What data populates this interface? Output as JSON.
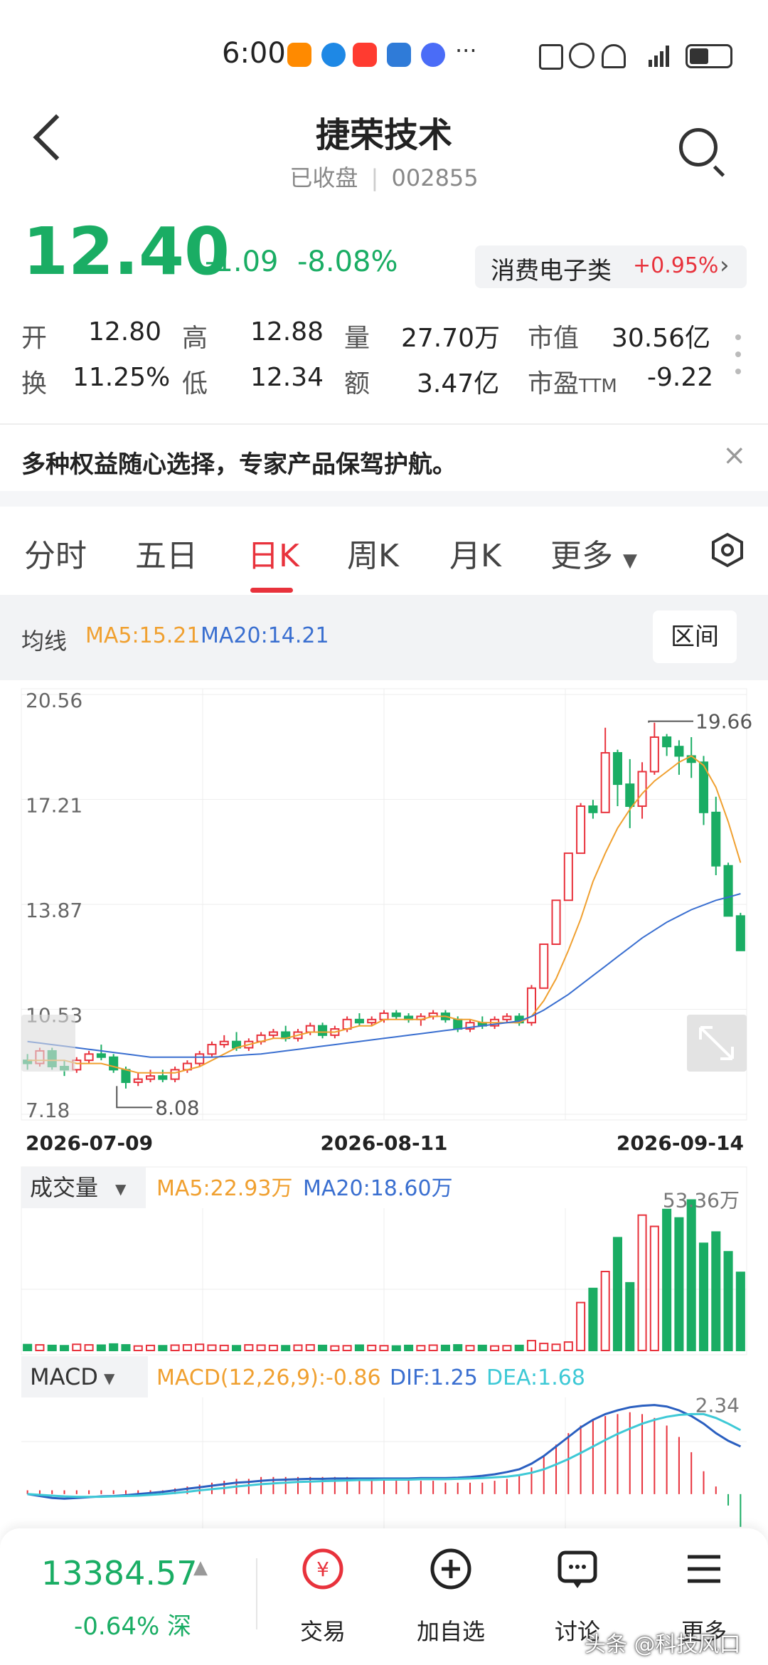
{
  "status_bar": {
    "time": "6:00",
    "more": "···"
  },
  "header": {
    "title": "捷荣技术",
    "status": "已收盘",
    "code": "002855"
  },
  "quote": {
    "price": "12.40",
    "change": "-1.09",
    "change_pct": "-8.08%",
    "sector_name": "消费电子类",
    "sector_change": "+0.95%"
  },
  "stats": {
    "open_label": "开",
    "open": "12.80",
    "high_label": "高",
    "high": "12.88",
    "volume_label": "量",
    "volume": "27.70万",
    "mktcap_label": "市值",
    "mktcap": "30.56亿",
    "turnover_label": "换",
    "turnover": "11.25%",
    "low_label": "低",
    "low": "12.34",
    "amount_label": "额",
    "amount": "3.47亿",
    "pe_label": "市盈",
    "pe_suffix": "TTM",
    "pe": "-9.22"
  },
  "banner": {
    "text": "多种权益随心选择，专家产品保驾护航。"
  },
  "tabs": [
    "分时",
    "五日",
    "日K",
    "周K",
    "月K",
    "更多"
  ],
  "ma": {
    "label": "均线",
    "ma5": "MA5:15.21",
    "ma20": "MA20:14.21",
    "interval_btn": "区间"
  },
  "volume_panel": {
    "label": "成交量",
    "ma5": "MA5:22.93万",
    "ma20": "MA20:18.60万",
    "max_label": "53.36万"
  },
  "macd_panel": {
    "label": "MACD",
    "macd": "MACD(12,26,9):-0.86",
    "dif": "DIF:1.25",
    "dea": "DEA:1.68",
    "max_label": "2.34"
  },
  "chart_data": {
    "type": "candlestick",
    "y_ticks": [
      "20.56",
      "17.21",
      "13.87",
      "10.53",
      "7.18"
    ],
    "ylim": [
      7.18,
      20.56
    ],
    "dates": [
      "2026-07-09",
      "2026-08-11",
      "2026-09-14"
    ],
    "high_marker": "19.66",
    "low_marker": "8.08",
    "candles": [
      [
        8.9,
        9.1,
        8.6,
        8.8
      ],
      [
        8.8,
        9.3,
        8.7,
        9.2
      ],
      [
        9.2,
        9.3,
        8.6,
        8.7
      ],
      [
        8.7,
        8.9,
        8.4,
        8.6
      ],
      [
        8.6,
        9.0,
        8.5,
        8.9
      ],
      [
        8.9,
        9.2,
        8.8,
        9.1
      ],
      [
        9.1,
        9.4,
        8.9,
        9.0
      ],
      [
        9.0,
        9.1,
        8.5,
        8.6
      ],
      [
        8.6,
        8.7,
        8.0,
        8.2
      ],
      [
        8.2,
        8.5,
        8.08,
        8.3
      ],
      [
        8.3,
        8.6,
        8.2,
        8.4
      ],
      [
        8.4,
        8.6,
        8.2,
        8.3
      ],
      [
        8.3,
        8.7,
        8.2,
        8.6
      ],
      [
        8.6,
        8.9,
        8.5,
        8.8
      ],
      [
        8.8,
        9.2,
        8.7,
        9.1
      ],
      [
        9.1,
        9.5,
        9.0,
        9.4
      ],
      [
        9.4,
        9.7,
        9.3,
        9.5
      ],
      [
        9.5,
        9.8,
        9.2,
        9.3
      ],
      [
        9.3,
        9.6,
        9.2,
        9.5
      ],
      [
        9.5,
        9.8,
        9.4,
        9.7
      ],
      [
        9.7,
        9.9,
        9.6,
        9.8
      ],
      [
        9.8,
        10.0,
        9.5,
        9.6
      ],
      [
        9.6,
        9.9,
        9.5,
        9.8
      ],
      [
        9.8,
        10.1,
        9.7,
        10.0
      ],
      [
        10.0,
        10.1,
        9.6,
        9.7
      ],
      [
        9.7,
        10.0,
        9.6,
        9.9
      ],
      [
        9.9,
        10.3,
        9.8,
        10.2
      ],
      [
        10.2,
        10.4,
        10.0,
        10.1
      ],
      [
        10.1,
        10.3,
        10.0,
        10.2
      ],
      [
        10.2,
        10.5,
        10.1,
        10.4
      ],
      [
        10.4,
        10.5,
        10.2,
        10.3
      ],
      [
        10.3,
        10.4,
        10.1,
        10.2
      ],
      [
        10.2,
        10.4,
        10.0,
        10.3
      ],
      [
        10.3,
        10.5,
        10.2,
        10.4
      ],
      [
        10.4,
        10.5,
        10.1,
        10.2
      ],
      [
        10.2,
        10.3,
        9.8,
        9.9
      ],
      [
        9.9,
        10.2,
        9.8,
        10.1
      ],
      [
        10.1,
        10.3,
        9.9,
        10.0
      ],
      [
        10.0,
        10.3,
        9.9,
        10.2
      ],
      [
        10.2,
        10.4,
        10.1,
        10.3
      ],
      [
        10.3,
        10.4,
        10.0,
        10.1
      ],
      [
        10.1,
        11.3,
        10.0,
        11.2
      ],
      [
        11.2,
        12.6,
        11.2,
        12.6
      ],
      [
        12.6,
        14.0,
        12.6,
        14.0
      ],
      [
        14.0,
        15.5,
        14.0,
        15.5
      ],
      [
        15.5,
        17.1,
        15.5,
        17.0
      ],
      [
        17.0,
        17.2,
        16.6,
        16.8
      ],
      [
        16.8,
        19.5,
        16.8,
        18.7
      ],
      [
        18.7,
        18.8,
        17.0,
        17.7
      ],
      [
        17.7,
        18.5,
        16.3,
        17.0
      ],
      [
        17.0,
        18.4,
        16.6,
        18.1
      ],
      [
        18.1,
        19.66,
        18.0,
        19.2
      ],
      [
        19.2,
        19.3,
        18.6,
        18.9
      ],
      [
        18.9,
        19.1,
        18.0,
        18.6
      ],
      [
        18.6,
        19.2,
        17.9,
        18.4
      ],
      [
        18.4,
        18.6,
        16.4,
        16.8
      ],
      [
        16.8,
        17.3,
        14.8,
        15.1
      ],
      [
        15.1,
        15.2,
        13.5,
        13.5
      ],
      [
        13.5,
        13.6,
        12.4,
        12.4
      ]
    ],
    "ma5": [
      8.9,
      8.9,
      8.9,
      8.9,
      8.8,
      8.8,
      8.8,
      8.7,
      8.6,
      8.5,
      8.5,
      8.5,
      8.5,
      8.6,
      8.7,
      8.9,
      9.1,
      9.3,
      9.4,
      9.5,
      9.6,
      9.6,
      9.7,
      9.8,
      9.8,
      9.8,
      9.9,
      10.0,
      10.0,
      10.2,
      10.2,
      10.2,
      10.2,
      10.3,
      10.3,
      10.2,
      10.2,
      10.1,
      10.1,
      10.1,
      10.1,
      10.3,
      10.8,
      11.5,
      12.4,
      13.4,
      14.6,
      15.5,
      16.3,
      16.9,
      17.4,
      17.8,
      18.1,
      18.4,
      18.6,
      18.3,
      17.6,
      16.5,
      15.2
    ],
    "ma20": [
      9.5,
      9.45,
      9.4,
      9.35,
      9.3,
      9.25,
      9.2,
      9.15,
      9.1,
      9.05,
      9.0,
      9.0,
      9.0,
      9.0,
      9.0,
      9.0,
      9.02,
      9.05,
      9.08,
      9.1,
      9.15,
      9.2,
      9.25,
      9.3,
      9.35,
      9.4,
      9.45,
      9.5,
      9.55,
      9.6,
      9.65,
      9.7,
      9.75,
      9.8,
      9.85,
      9.9,
      9.95,
      10.0,
      10.05,
      10.1,
      10.15,
      10.3,
      10.5,
      10.75,
      11.0,
      11.3,
      11.6,
      11.9,
      12.2,
      12.5,
      12.8,
      13.05,
      13.3,
      13.5,
      13.7,
      13.85,
      14.0,
      14.1,
      14.21
    ],
    "volume": [
      2.1,
      2.0,
      1.8,
      1.7,
      2.2,
      2.0,
      1.9,
      2.3,
      2.0,
      1.6,
      1.8,
      1.7,
      1.9,
      2.0,
      2.2,
      1.9,
      1.8,
      1.7,
      2.0,
      1.9,
      1.8,
      1.7,
      1.9,
      2.0,
      1.8,
      1.6,
      1.7,
      1.9,
      1.8,
      1.7,
      1.6,
      1.8,
      1.7,
      1.9,
      1.8,
      2.0,
      1.7,
      1.8,
      1.6,
      1.7,
      1.8,
      3.5,
      2.5,
      2.2,
      3.0,
      17.0,
      22.0,
      28.0,
      40.0,
      24.0,
      48.0,
      44.0,
      50.0,
      47.0,
      53.36,
      38.0,
      42.0,
      35.0,
      27.7
    ],
    "vol_ylim": [
      0,
      56
    ],
    "macd_hist": [
      0.1,
      0.1,
      0.1,
      0.1,
      0.1,
      0.1,
      0.1,
      0.1,
      0.1,
      0.1,
      0.1,
      0.1,
      0.15,
      0.2,
      0.25,
      0.3,
      0.35,
      0.4,
      0.4,
      0.45,
      0.45,
      0.45,
      0.45,
      0.45,
      0.45,
      0.45,
      0.45,
      0.4,
      0.4,
      0.4,
      0.35,
      0.35,
      0.35,
      0.35,
      0.3,
      0.3,
      0.3,
      0.3,
      0.35,
      0.4,
      0.5,
      0.7,
      1.0,
      1.3,
      1.6,
      1.8,
      1.95,
      2.05,
      2.1,
      2.15,
      2.1,
      2.0,
      1.8,
      1.5,
      1.1,
      0.6,
      0.2,
      -0.3,
      -0.86
    ],
    "dif": [
      0.0,
      -0.05,
      -0.1,
      -0.12,
      -0.1,
      -0.08,
      -0.06,
      -0.05,
      -0.03,
      0.0,
      0.03,
      0.06,
      0.1,
      0.14,
      0.18,
      0.22,
      0.26,
      0.3,
      0.32,
      0.35,
      0.37,
      0.38,
      0.39,
      0.4,
      0.4,
      0.41,
      0.41,
      0.41,
      0.41,
      0.41,
      0.41,
      0.41,
      0.42,
      0.42,
      0.42,
      0.43,
      0.45,
      0.48,
      0.52,
      0.58,
      0.65,
      0.8,
      1.0,
      1.25,
      1.5,
      1.75,
      1.95,
      2.1,
      2.2,
      2.28,
      2.32,
      2.34,
      2.3,
      2.2,
      2.05,
      1.85,
      1.6,
      1.4,
      1.25
    ],
    "dea": [
      0.0,
      -0.02,
      -0.04,
      -0.06,
      -0.07,
      -0.07,
      -0.07,
      -0.06,
      -0.05,
      -0.04,
      -0.02,
      0.0,
      0.03,
      0.06,
      0.1,
      0.13,
      0.16,
      0.2,
      0.23,
      0.26,
      0.28,
      0.3,
      0.32,
      0.33,
      0.34,
      0.35,
      0.36,
      0.37,
      0.37,
      0.38,
      0.38,
      0.38,
      0.39,
      0.39,
      0.39,
      0.4,
      0.41,
      0.42,
      0.44,
      0.46,
      0.5,
      0.56,
      0.65,
      0.78,
      0.92,
      1.08,
      1.25,
      1.42,
      1.58,
      1.72,
      1.85,
      1.95,
      2.03,
      2.08,
      2.1,
      2.1,
      2.0,
      1.85,
      1.68
    ],
    "macd_ylim": [
      -0.9,
      2.5
    ]
  },
  "dock": {
    "index_value": "13384.57",
    "index_change": "-0.64%",
    "index_market": "深",
    "buttons": [
      "交易",
      "加自选",
      "讨论",
      "更多"
    ]
  },
  "watermark": "头条 @科技风口"
}
